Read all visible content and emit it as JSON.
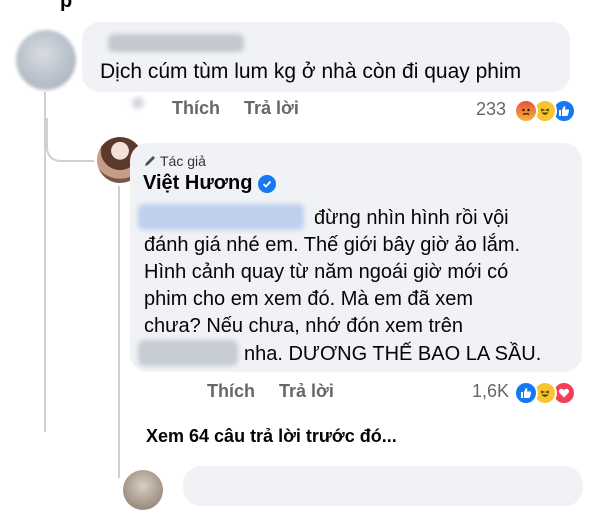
{
  "top_partial_text": "p",
  "comment1": {
    "text": "Dịch cúm tùm lum kg ở nhà còn đi quay phim",
    "actions": {
      "like": "Thích",
      "reply": "Trả lời"
    },
    "reaction_count": "233",
    "reactions": [
      "angry-icon",
      "haha-icon",
      "like-icon"
    ]
  },
  "reply": {
    "author_tag": "Tác giả",
    "author_name": "Việt Hương",
    "lines": [
      "đừng nhìn hình rồi vội",
      "đánh giá nhé em. Thế giới bây giờ ảo lắm.",
      "Hình cảnh quay từ năm ngoái giờ mới có",
      "phim cho em xem đó. Mà em đã xem",
      "chưa? Nếu chưa, nhớ đón xem trên",
      "nha. DƯƠNG THẾ BAO LA SẦU."
    ],
    "actions": {
      "like": "Thích",
      "reply": "Trả lời"
    },
    "reaction_count": "1,6K",
    "reactions": [
      "like-icon",
      "haha-icon",
      "love-icon"
    ]
  },
  "see_more": "Xem 64 câu trả lời trước đó...",
  "colors": {
    "bubble": "#f0f2f5",
    "meta_text": "#65676b",
    "facebook_blue": "#1877f2",
    "thread_line": "#ced0d4"
  }
}
